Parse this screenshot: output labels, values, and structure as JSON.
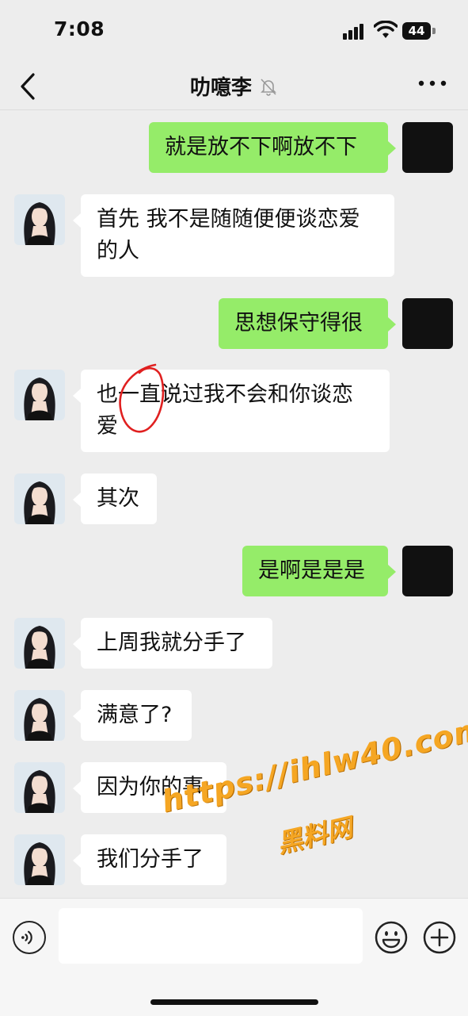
{
  "status_bar": {
    "time": "7:08",
    "battery": "44"
  },
  "nav": {
    "title": "叻噫李",
    "back_icon": "chevron-left-icon",
    "mute_icon": "bell-slash-icon",
    "more_icon": "more-dots-icon"
  },
  "messages": [
    {
      "side": "out",
      "text": "就是放不下啊放不下"
    },
    {
      "side": "in",
      "text": "首先 我不是随随便便谈恋爱的人"
    },
    {
      "side": "out",
      "text": "思想保守得很"
    },
    {
      "side": "in",
      "text": "也一直说过我不会和你谈恋爱"
    },
    {
      "side": "in",
      "text": "其次"
    },
    {
      "side": "out",
      "text": "是啊是是是"
    },
    {
      "side": "in",
      "text": "上周我就分手了"
    },
    {
      "side": "in",
      "text": "满意了?"
    },
    {
      "side": "in",
      "text": "因为你的事"
    },
    {
      "side": "in",
      "text": "我们分手了"
    }
  ],
  "watermark": {
    "url": "https://ihlw40.com",
    "name": "黑料网"
  },
  "input": {
    "value": "",
    "placeholder": ""
  },
  "colors": {
    "out_bubble": "#95ec69",
    "in_bubble": "#ffffff",
    "background": "#ededed",
    "annotation": "#e02020",
    "watermark": "#f5a623"
  }
}
